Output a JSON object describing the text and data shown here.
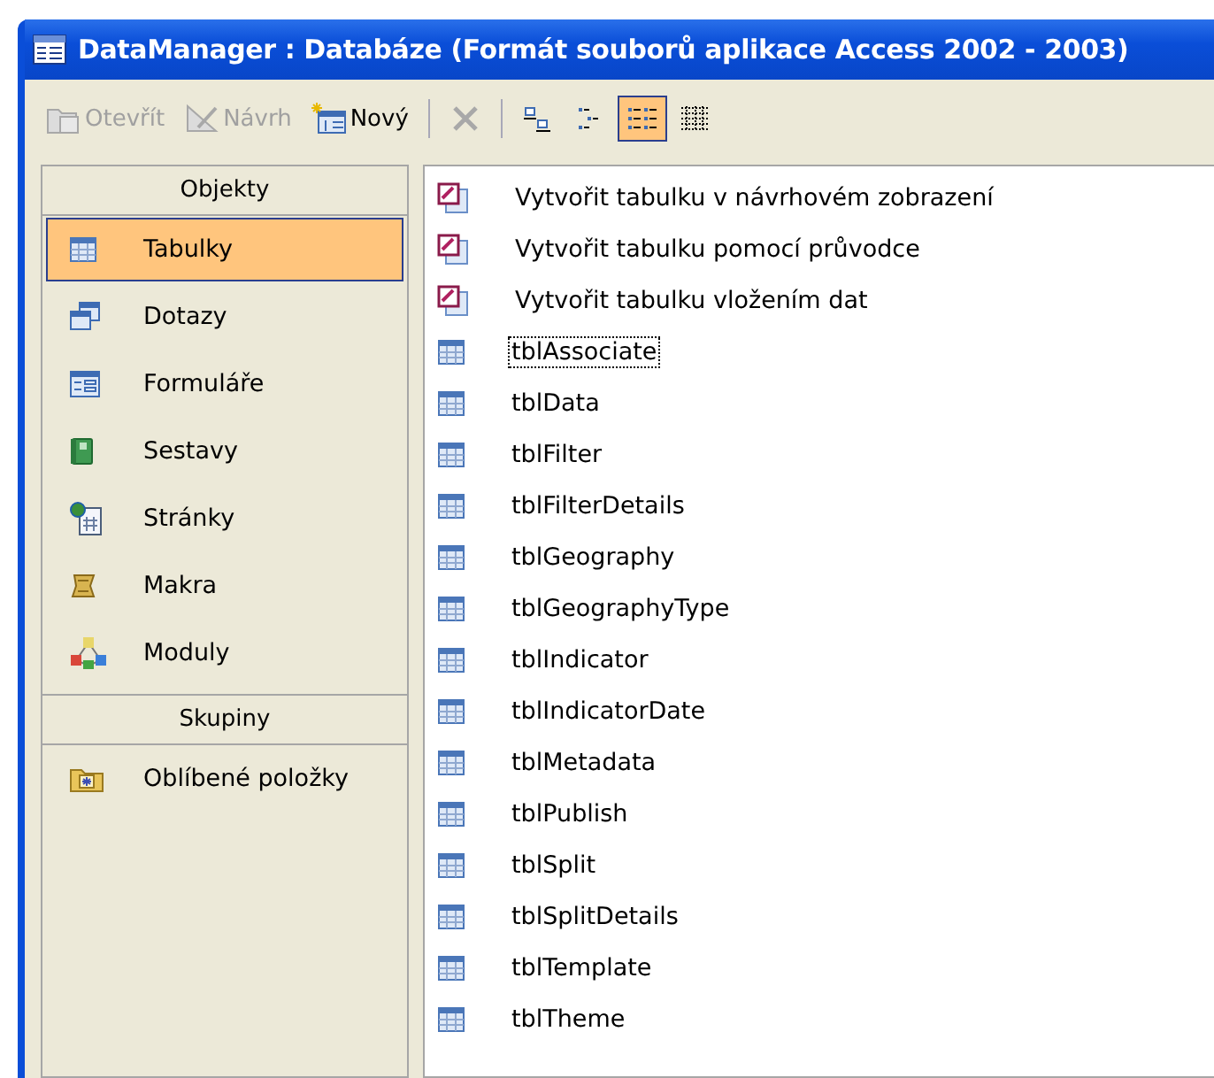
{
  "window": {
    "title": "DataManager : Databáze (Formát souborů aplikace Access 2002 - 2003)"
  },
  "toolbar": [
    {
      "kind": "button",
      "label": "Otevřít",
      "disabled": true
    },
    {
      "kind": "button",
      "label": "Návrh",
      "disabled": true
    },
    {
      "kind": "button",
      "label": "Nový",
      "disabled": false
    },
    {
      "kind": "separator"
    },
    {
      "kind": "button",
      "disabled": true
    },
    {
      "kind": "separator"
    },
    {
      "kind": "view",
      "selected": false
    },
    {
      "kind": "view",
      "selected": false
    },
    {
      "kind": "view",
      "selected": true
    },
    {
      "kind": "view",
      "selected": false
    }
  ],
  "sidebar": {
    "sections": [
      {
        "title": "Objekty",
        "items": [
          {
            "label": "Tabulky",
            "selected": true
          },
          {
            "label": "Dotazy",
            "selected": false
          },
          {
            "label": "Formuláře",
            "selected": false
          },
          {
            "label": "Sestavy",
            "selected": false
          },
          {
            "label": "Stránky",
            "selected": false
          },
          {
            "label": "Makra",
            "selected": false
          },
          {
            "label": "Moduly",
            "selected": false
          }
        ]
      },
      {
        "title": "Skupiny",
        "items": [
          {
            "label": "Oblíbené položky",
            "selected": false
          }
        ]
      }
    ]
  },
  "objects": [
    {
      "kind": "action",
      "label": "Vytvořit tabulku v návrhovém zobrazení",
      "focused": false
    },
    {
      "kind": "action",
      "label": "Vytvořit tabulku pomocí průvodce",
      "focused": false
    },
    {
      "kind": "action",
      "label": "Vytvořit tabulku vložením dat",
      "focused": false
    },
    {
      "kind": "table",
      "label": "tblAssociate",
      "focused": true
    },
    {
      "kind": "table",
      "label": "tblData",
      "focused": false
    },
    {
      "kind": "table",
      "label": "tblFilter",
      "focused": false
    },
    {
      "kind": "table",
      "label": "tblFilterDetails",
      "focused": false
    },
    {
      "kind": "table",
      "label": "tblGeography",
      "focused": false
    },
    {
      "kind": "table",
      "label": "tblGeographyType",
      "focused": false
    },
    {
      "kind": "table",
      "label": "tblIndicator",
      "focused": false
    },
    {
      "kind": "table",
      "label": "tblIndicatorDate",
      "focused": false
    },
    {
      "kind": "table",
      "label": "tblMetadata",
      "focused": false
    },
    {
      "kind": "table",
      "label": "tblPublish",
      "focused": false
    },
    {
      "kind": "table",
      "label": "tblSplit",
      "focused": false
    },
    {
      "kind": "table",
      "label": "tblSplitDetails",
      "focused": false
    },
    {
      "kind": "table",
      "label": "tblTemplate",
      "focused": false
    },
    {
      "kind": "table",
      "label": "tblTheme",
      "focused": false
    }
  ]
}
